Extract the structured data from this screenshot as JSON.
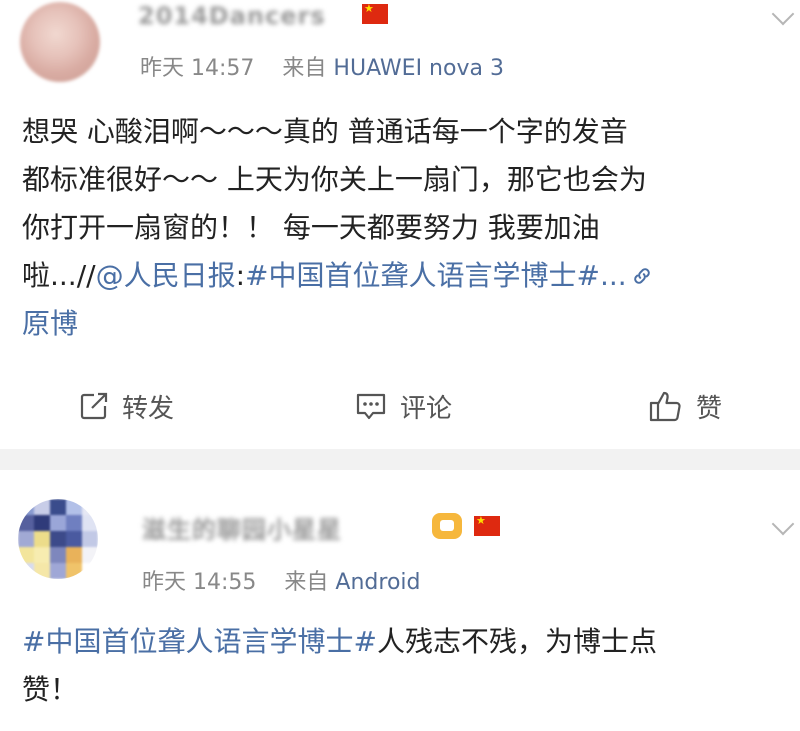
{
  "post1": {
    "username": "2014Dancers",
    "time": "昨天 14:57",
    "source_prefix": "来自",
    "source": "HUAWEI nova 3",
    "text_lines": [
      "想哭 心酸泪啊～～～真的 普通话每一个字的发音",
      "都标准很好～～ 上天为你关上一扇门，那它也会为",
      "你打开一扇窗的！！ 每一天都要努力 我要加油"
    ],
    "line4_plain": "啦...//",
    "line4_mention": "@人民日报",
    "line4_colon": ":",
    "line4_topic": "#中国首位聋人语言学博士#...",
    "origin_link": "原博",
    "actions": {
      "forward": "转发",
      "comment": "评论",
      "like": "赞"
    }
  },
  "post2": {
    "username": "滋生的聊园小星星",
    "time": "昨天 14:55",
    "source_prefix": "来自",
    "source": "Android",
    "topic": "#中国首位聋人语言学博士#",
    "text_rest": "人残志不残，为博士点",
    "text_line2": "赞！"
  },
  "colors": {
    "link": "#4a6fa5",
    "meta": "#888888",
    "separator": "#f2f2f2"
  },
  "icons": [
    "share-icon",
    "comment-icon",
    "thumbs-up-icon",
    "chevron-down-icon",
    "link-icon",
    "china-flag-icon",
    "crown-badge-icon"
  ]
}
